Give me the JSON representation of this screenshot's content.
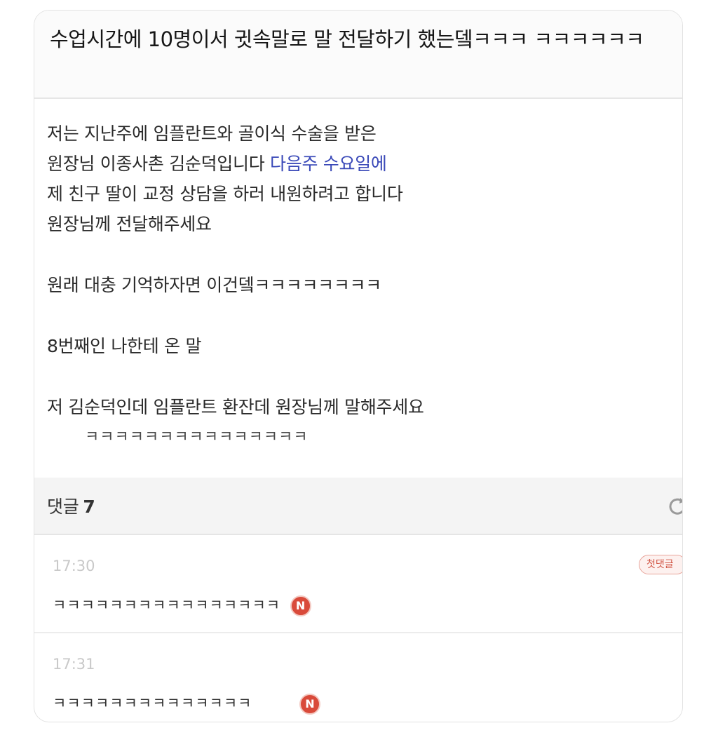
{
  "post": {
    "title": "수업시간에 10명이서 귓속말로 말 전달하기 했는뎈ㅋㅋㅋ ㅋㅋㅋㅋㅋㅋ",
    "lines": [
      {
        "before": "저는 지난주에 임플란트와 골이식 수술을 받은",
        "highlight": ""
      },
      {
        "before": "원장님 이종사촌 김순덕입니다 ",
        "highlight": "다음주 수요일에"
      },
      {
        "before": "제 친구 딸이 교정 상담을 하러 내원하려고 합니다",
        "highlight": ""
      },
      {
        "before": "원장님께 전달해주세요",
        "highlight": ""
      }
    ],
    "para2": "원래 대충 기억하자면 이건뎈ㅋㅋㅋㅋㅋㅋㅋㅋ",
    "para3": "8번째인 나한테 온 말",
    "para4": "저 김순덕인데 임플란트 환잔데 원장님께 말해주세요",
    "para5": "ㅋㅋㅋㅋㅋㅋㅋㅋㅋㅋㅋㅋㅋㅋㅋ"
  },
  "comments": {
    "label": "댓글",
    "count": "7",
    "items": [
      {
        "time": "17:30",
        "text": "ㅋㅋㅋㅋㅋㅋㅋㅋㅋㅋㅋㅋㅋㅋㅋㅋ",
        "badge": "N",
        "first_badge": "첫댓글"
      },
      {
        "time": "17:31",
        "text": "ㅋㅋㅋㅋㅋㅋㅋㅋㅋㅋㅋㅋㅋㅋ",
        "badge": "N"
      }
    ]
  },
  "icons": {
    "refresh": "refresh-icon",
    "new": "new-badge"
  },
  "colors": {
    "highlight": "#3a49b8",
    "badge": "#d94a3a"
  }
}
